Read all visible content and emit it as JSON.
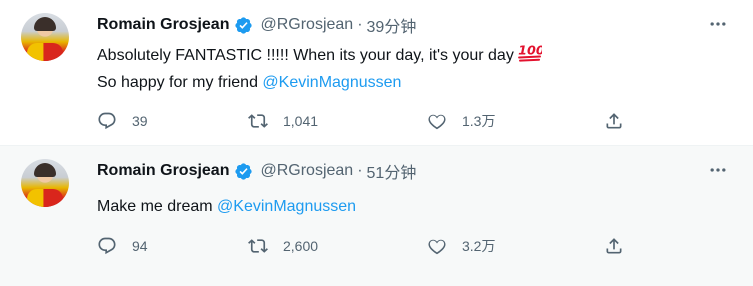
{
  "tweets": [
    {
      "author": {
        "name": "Romain Grosjean",
        "handle": "@RGrosjean"
      },
      "time": "39分钟",
      "lines": [
        {
          "text": "Absolutely FANTASTIC !!!!! When its your day, it's your day",
          "emoji": "hundred-points-icon"
        },
        {
          "text": "So happy for my friend ",
          "mention": "@KevinMagnussen"
        }
      ],
      "counts": {
        "replies": "39",
        "retweets": "1,041",
        "likes": "1.3万"
      }
    },
    {
      "author": {
        "name": "Romain Grosjean",
        "handle": "@RGrosjean"
      },
      "time": "51分钟",
      "lines": [
        {
          "text": "Make me dream ",
          "mention": "@KevinMagnussen"
        }
      ],
      "counts": {
        "replies": "94",
        "retweets": "2,600",
        "likes": "3.2万"
      }
    }
  ],
  "header_separator": "·",
  "colors": {
    "accent": "#1d9bf0",
    "secondary_text": "#536471",
    "primary_text": "#0f1419",
    "hover_background": "#f7f9f9",
    "hundred_points_red": "#e3122f"
  },
  "icons": [
    "verified-badge-icon",
    "more-icon",
    "reply-icon",
    "retweet-icon",
    "like-icon",
    "share-icon",
    "hundred-points-icon"
  ]
}
